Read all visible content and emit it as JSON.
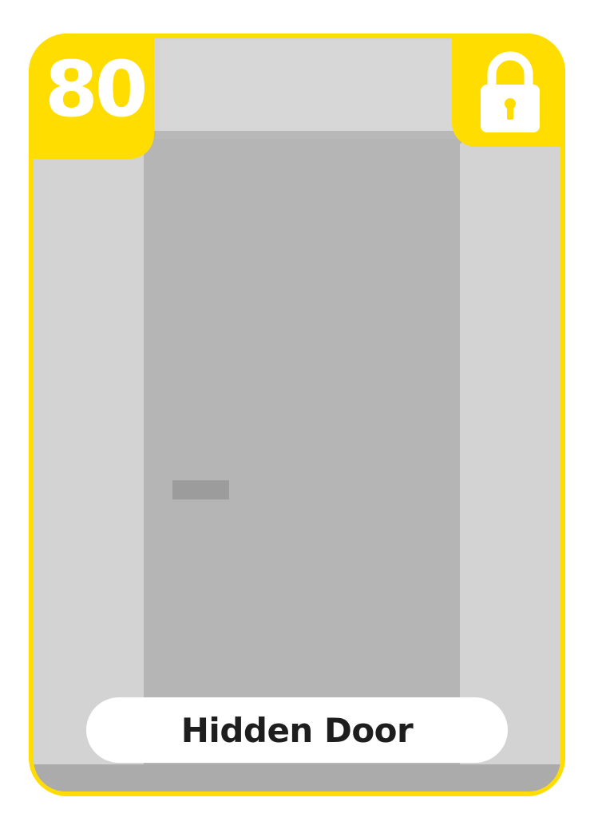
{
  "card": {
    "cost": "80",
    "name": "Hidden Door",
    "status_icon": "padlock-icon"
  },
  "colors": {
    "frame": "#FFDD00",
    "wall": "#D3D3D3",
    "door": "#B5B5B5",
    "handle": "#9C9C9C",
    "floor": "#ABABAB",
    "banner": "#FFFFFF",
    "name_text": "#1E1E1E"
  }
}
